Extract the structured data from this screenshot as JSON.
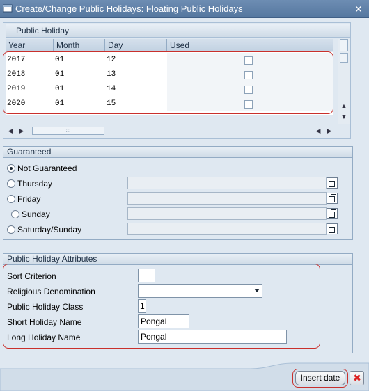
{
  "window": {
    "title": "Create/Change Public Holidays: Floating Public Holidays"
  },
  "table": {
    "title": "Public Holiday",
    "columns": [
      "Year",
      "Month",
      "Day",
      "Used"
    ],
    "rows": [
      {
        "year": "2017",
        "month": "01",
        "day": "12",
        "used": false
      },
      {
        "year": "2018",
        "month": "01",
        "day": "13",
        "used": false
      },
      {
        "year": "2019",
        "month": "01",
        "day": "14",
        "used": false
      },
      {
        "year": "2020",
        "month": "01",
        "day": "15",
        "used": false
      }
    ]
  },
  "guaranteed": {
    "title": "Guaranteed",
    "options": [
      {
        "label": "Not Guaranteed",
        "selected": true
      },
      {
        "label": "Thursday",
        "selected": false
      },
      {
        "label": "Friday",
        "selected": false
      },
      {
        "label": "Sunday",
        "selected": false
      },
      {
        "label": "Saturday/Sunday",
        "selected": false
      }
    ]
  },
  "attributes": {
    "title": "Public Holiday Attributes",
    "sort_criterion": {
      "label": "Sort Criterion",
      "value": ""
    },
    "religious_denomination": {
      "label": "Religious Denomination",
      "value": ""
    },
    "holiday_class": {
      "label": "Public Holiday Class",
      "value": "1"
    },
    "short_name": {
      "label": "Short Holiday Name",
      "value": "Pongal"
    },
    "long_name": {
      "label": "Long Holiday Name",
      "value": "Pongal"
    }
  },
  "footer": {
    "insert_label": "Insert date"
  },
  "colors": {
    "highlight": "#c9302c",
    "titlebar": "#5f80a8",
    "background": "#dfe8f1"
  }
}
